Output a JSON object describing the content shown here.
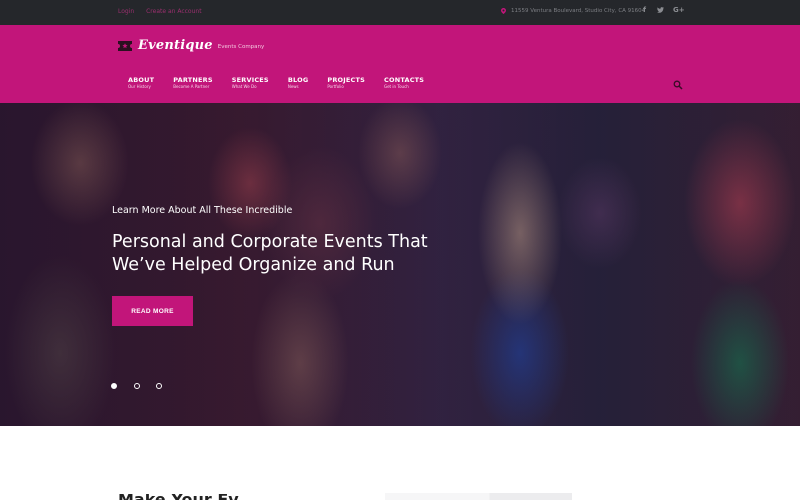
{
  "topbar": {
    "login": "Login",
    "create_account": "Create an Account",
    "address": "11559 Ventura Boulevard, Studio City, CA 91604",
    "social": [
      {
        "icon": "facebook-icon",
        "glyph": "f"
      },
      {
        "icon": "twitter-icon",
        "glyph": "t"
      },
      {
        "icon": "google-plus-icon",
        "glyph": "G+"
      }
    ]
  },
  "brand": {
    "name": "Eventique",
    "tagline": "Events Company"
  },
  "nav": {
    "items": [
      {
        "label": "ABOUT",
        "sub": "Our History"
      },
      {
        "label": "PARTNERS",
        "sub": "Become A Partner"
      },
      {
        "label": "SERVICES",
        "sub": "What We Do"
      },
      {
        "label": "BLOG",
        "sub": "News"
      },
      {
        "label": "PROJECTS",
        "sub": "Portfolio"
      },
      {
        "label": "CONTACTS",
        "sub": "Get in Touch"
      }
    ]
  },
  "hero": {
    "kicker": "Learn More About All These Incredible",
    "title": "Personal and Corporate Events That We’ve Helped Organize and Run",
    "button": "READ MORE",
    "slides": 3,
    "active_slide": 1
  },
  "section": {
    "heading": "Make Your Ev"
  },
  "colors": {
    "accent": "#c2157a",
    "topbar": "#25272b",
    "link": "#9a2f6e"
  }
}
